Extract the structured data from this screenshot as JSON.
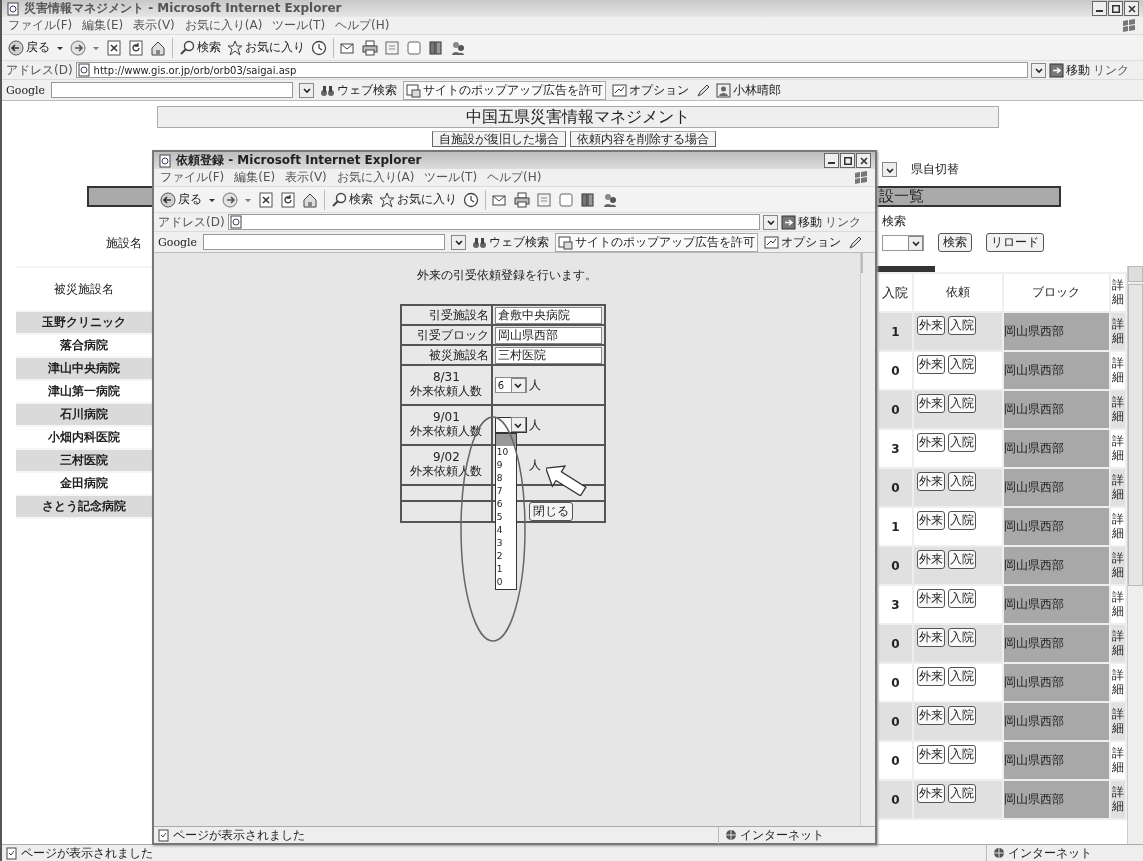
{
  "window": {
    "title": "災害情報マネジメント - Microsoft Internet Explorer",
    "menu": [
      "ファイル(F)",
      "編集(E)",
      "表示(V)",
      "お気に入り(A)",
      "ツール(T)",
      "ヘルプ(H)"
    ],
    "toolbar": {
      "back": "戻る",
      "search": "検索",
      "favorites": "お気に入り"
    },
    "address": {
      "label": "アドレス(D)",
      "value": "http://www.gis.or.jp/orb/orb03/saigai.asp",
      "go": "移動",
      "links": "リンク"
    },
    "google_bar": {
      "logo": "Google",
      "search": "ウェブ検索",
      "popup": "サイトのポップアップ広告を許可",
      "options": "オプション",
      "user": "小林晴郎"
    }
  },
  "page": {
    "title": "中国五県災害情報マネジメント",
    "buttons": [
      "自施設が復旧した場合",
      "依頼内容を削除する場合"
    ],
    "pref_label": "県自切替",
    "list_heading": "設一覧",
    "facility_label": "施設名",
    "search_label": "検索",
    "search_button": "検索",
    "reload_button": "リロード",
    "facilities": {
      "header": "被災施設名",
      "rows": [
        {
          "name": "玉野クリニック"
        },
        {
          "name": "落合病院"
        },
        {
          "name": "津山中央病院"
        },
        {
          "name": "津山第一病院"
        },
        {
          "name": "石川病院"
        },
        {
          "name": "小畑内科医院"
        },
        {
          "name": "三村医院"
        },
        {
          "name": "金田病院"
        },
        {
          "name": "さとう記念病院"
        }
      ]
    },
    "requests": {
      "columns": [
        "入院",
        "依頼",
        "ブロック",
        "詳細"
      ],
      "rows": [
        {
          "inpatient": "1",
          "buttons": [
            "外来",
            "入院"
          ],
          "block": "岡山県西部",
          "detail": "詳細"
        },
        {
          "inpatient": "0",
          "buttons": [
            "外来",
            "入院"
          ],
          "block": "岡山県西部",
          "detail": "詳細"
        },
        {
          "inpatient": "0",
          "buttons": [
            "外来",
            "入院"
          ],
          "block": "岡山県西部",
          "detail": "詳細"
        },
        {
          "inpatient": "3",
          "buttons": [
            "外来",
            "入院"
          ],
          "block": "岡山県西部",
          "detail": "詳細"
        },
        {
          "inpatient": "0",
          "buttons": [
            "外来",
            "入院"
          ],
          "block": "岡山県西部",
          "detail": "詳細"
        },
        {
          "inpatient": "1",
          "buttons": [
            "外来",
            "入院"
          ],
          "block": "岡山県西部",
          "detail": "詳細"
        },
        {
          "inpatient": "0",
          "buttons": [
            "外来",
            "入院"
          ],
          "block": "岡山県西部",
          "detail": "詳細"
        },
        {
          "inpatient": "3",
          "buttons": [
            "外来",
            "入院"
          ],
          "block": "岡山県西部",
          "detail": "詳細"
        },
        {
          "inpatient": "0",
          "buttons": [
            "外来",
            "入院"
          ],
          "block": "岡山県西部",
          "detail": "詳細"
        },
        {
          "inpatient": "0",
          "buttons": [
            "外来",
            "入院"
          ],
          "block": "岡山県西部",
          "detail": "詳細"
        },
        {
          "inpatient": "0",
          "buttons": [
            "外来",
            "入院"
          ],
          "block": "岡山県西部",
          "detail": "詳細"
        },
        {
          "inpatient": "0",
          "buttons": [
            "外来",
            "入院"
          ],
          "block": "岡山県西部",
          "detail": "詳細"
        },
        {
          "inpatient": "0",
          "buttons": [
            "外来",
            "入院"
          ],
          "block": "岡山県西部",
          "detail": "詳細"
        }
      ]
    }
  },
  "popup": {
    "title": "依頼登録 - Microsoft Internet Explorer",
    "menu": [
      "ファイル(F)",
      "編集(E)",
      "表示(V)",
      "お気に入り(A)",
      "ツール(T)",
      "ヘルプ(H)"
    ],
    "toolbar": {
      "back": "戻る",
      "search": "検索",
      "favorites": "お気に入り"
    },
    "address": {
      "label": "アドレス(D)",
      "go": "移動",
      "links": "リンク"
    },
    "google_bar": {
      "logo": "Google",
      "search": "ウェブ検索",
      "popup": "サイトのポップアップ広告を許可",
      "options": "オプション"
    },
    "heading": "外来の引受依頼登録を行います。",
    "form": [
      {
        "kind": "text",
        "label": "引受施設名",
        "value": "倉敷中央病院"
      },
      {
        "kind": "text",
        "label": "引受ブロック",
        "value": "岡山県西部"
      },
      {
        "kind": "text",
        "label": "被災施設名",
        "value": "三村医院"
      },
      {
        "kind": "select",
        "date": "8/31",
        "label": "外来依頼人数",
        "value": "6",
        "unit": "人",
        "open": false
      },
      {
        "kind": "select",
        "date": "9/01",
        "label": "外来依頼人数",
        "unit": "人",
        "open": true,
        "options": [
          "10",
          "9",
          "8",
          "7",
          "6",
          "5",
          "4",
          "3",
          "2",
          "1",
          "0"
        ]
      },
      {
        "kind": "unit",
        "date": "9/02",
        "label": "外来依頼人数",
        "unit": "人"
      },
      {
        "kind": "blank"
      },
      {
        "kind": "button",
        "label": "閉じる"
      }
    ],
    "status_bar": {
      "text": "ページが表示されました",
      "zone": "インターネット"
    }
  },
  "status_bar": {
    "text": "ページが表示されました",
    "zone": "インターネット"
  }
}
